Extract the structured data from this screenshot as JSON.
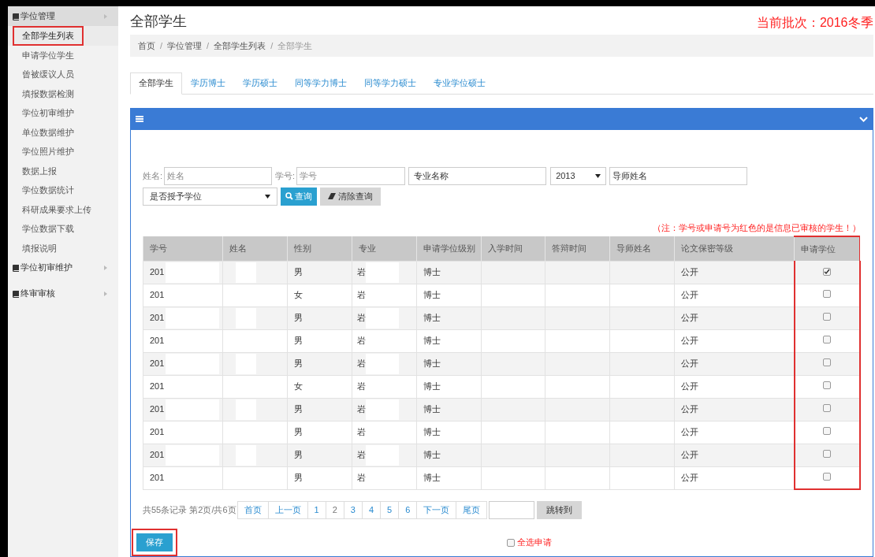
{
  "sidebar": {
    "groups": [
      {
        "label": "学位管理",
        "expanded": true,
        "items": [
          {
            "label": "全部学生列表",
            "selected": true
          },
          {
            "label": "申请学位学生",
            "selected": false
          },
          {
            "label": "曾被缓议人员",
            "selected": false
          },
          {
            "label": "填报数据检测",
            "selected": false
          },
          {
            "label": "学位初审维护",
            "selected": false
          },
          {
            "label": "单位数据维护",
            "selected": false
          },
          {
            "label": "学位照片维护",
            "selected": false
          },
          {
            "label": "数据上报",
            "selected": false
          },
          {
            "label": "学位数据统计",
            "selected": false
          },
          {
            "label": "科研成果要求上传",
            "selected": false
          },
          {
            "label": "学位数据下载",
            "selected": false
          },
          {
            "label": "填报说明",
            "selected": false
          }
        ]
      },
      {
        "label": "学位初审维护",
        "expanded": false
      },
      {
        "label": "终审审核",
        "expanded": false
      }
    ]
  },
  "page_title": "全部学生",
  "batch": "当前批次：2016冬季",
  "breadcrumb": [
    "首页",
    "学位管理",
    "全部学生列表",
    "全部学生"
  ],
  "breadcrumb_separator": "/",
  "tabs": [
    {
      "label": "全部学生",
      "selected": true
    },
    {
      "label": "学历博士",
      "selected": false
    },
    {
      "label": "学历硕士",
      "selected": false
    },
    {
      "label": "同等学力博士",
      "selected": false
    },
    {
      "label": "同等学力硕士",
      "selected": false
    },
    {
      "label": "专业学位硕士",
      "selected": false
    }
  ],
  "filters": {
    "name_label": "姓名:",
    "name_placeholder": "姓名",
    "id_label": "学号:",
    "id_placeholder": "学号",
    "major_placeholder": "专业名称",
    "year": "2013",
    "advisor_placeholder": "导师姓名",
    "degree_select": "是否授予学位",
    "search_button": "查询",
    "clear_button": "清除查询"
  },
  "note": "（注：学号或申请号为红色的是信息已审核的学生！）",
  "table": {
    "columns": [
      "学号",
      "姓名",
      "性别",
      "专业",
      "申请学位级别",
      "入学时间",
      "答辩时间",
      "导师姓名",
      "论文保密等级",
      "申请学位"
    ],
    "rows": [
      {
        "id": "201",
        "gender": "男",
        "major": "岩",
        "level": "博士",
        "secrecy": "公开",
        "checked": true
      },
      {
        "id": "201",
        "gender": "女",
        "major": "岩",
        "level": "博士",
        "secrecy": "公开",
        "checked": false
      },
      {
        "id": "201",
        "gender": "男",
        "major": "岩",
        "level": "博士",
        "secrecy": "公开",
        "checked": false
      },
      {
        "id": "201",
        "gender": "男",
        "major": "岩",
        "level": "博士",
        "secrecy": "公开",
        "checked": false
      },
      {
        "id": "201",
        "gender": "男",
        "major": "岩",
        "level": "博士",
        "secrecy": "公开",
        "checked": false
      },
      {
        "id": "201",
        "gender": "女",
        "major": "岩",
        "level": "博士",
        "secrecy": "公开",
        "checked": false
      },
      {
        "id": "201",
        "gender": "男",
        "major": "岩",
        "level": "博士",
        "secrecy": "公开",
        "checked": false
      },
      {
        "id": "201",
        "gender": "男",
        "major": "岩",
        "level": "博士",
        "secrecy": "公开",
        "checked": false
      },
      {
        "id": "201",
        "gender": "男",
        "major": "岩",
        "level": "博士",
        "secrecy": "公开",
        "checked": false
      },
      {
        "id": "201",
        "gender": "男",
        "major": "岩",
        "level": "博士",
        "secrecy": "公开",
        "checked": false
      }
    ]
  },
  "pagination": {
    "summary": "共55条记录 第2页/共6页",
    "links": [
      {
        "label": "首页",
        "selected": false
      },
      {
        "label": "上一页",
        "selected": false
      },
      {
        "label": "1",
        "selected": false
      },
      {
        "label": "2",
        "selected": true
      },
      {
        "label": "3",
        "selected": false
      },
      {
        "label": "4",
        "selected": false
      },
      {
        "label": "5",
        "selected": false
      },
      {
        "label": "6",
        "selected": false
      },
      {
        "label": "下一页",
        "selected": false
      },
      {
        "label": "尾页",
        "selected": false
      }
    ],
    "jump_button": "跳转到"
  },
  "save_button": "保存",
  "select_all": {
    "label": "全选申请",
    "checked": false
  }
}
